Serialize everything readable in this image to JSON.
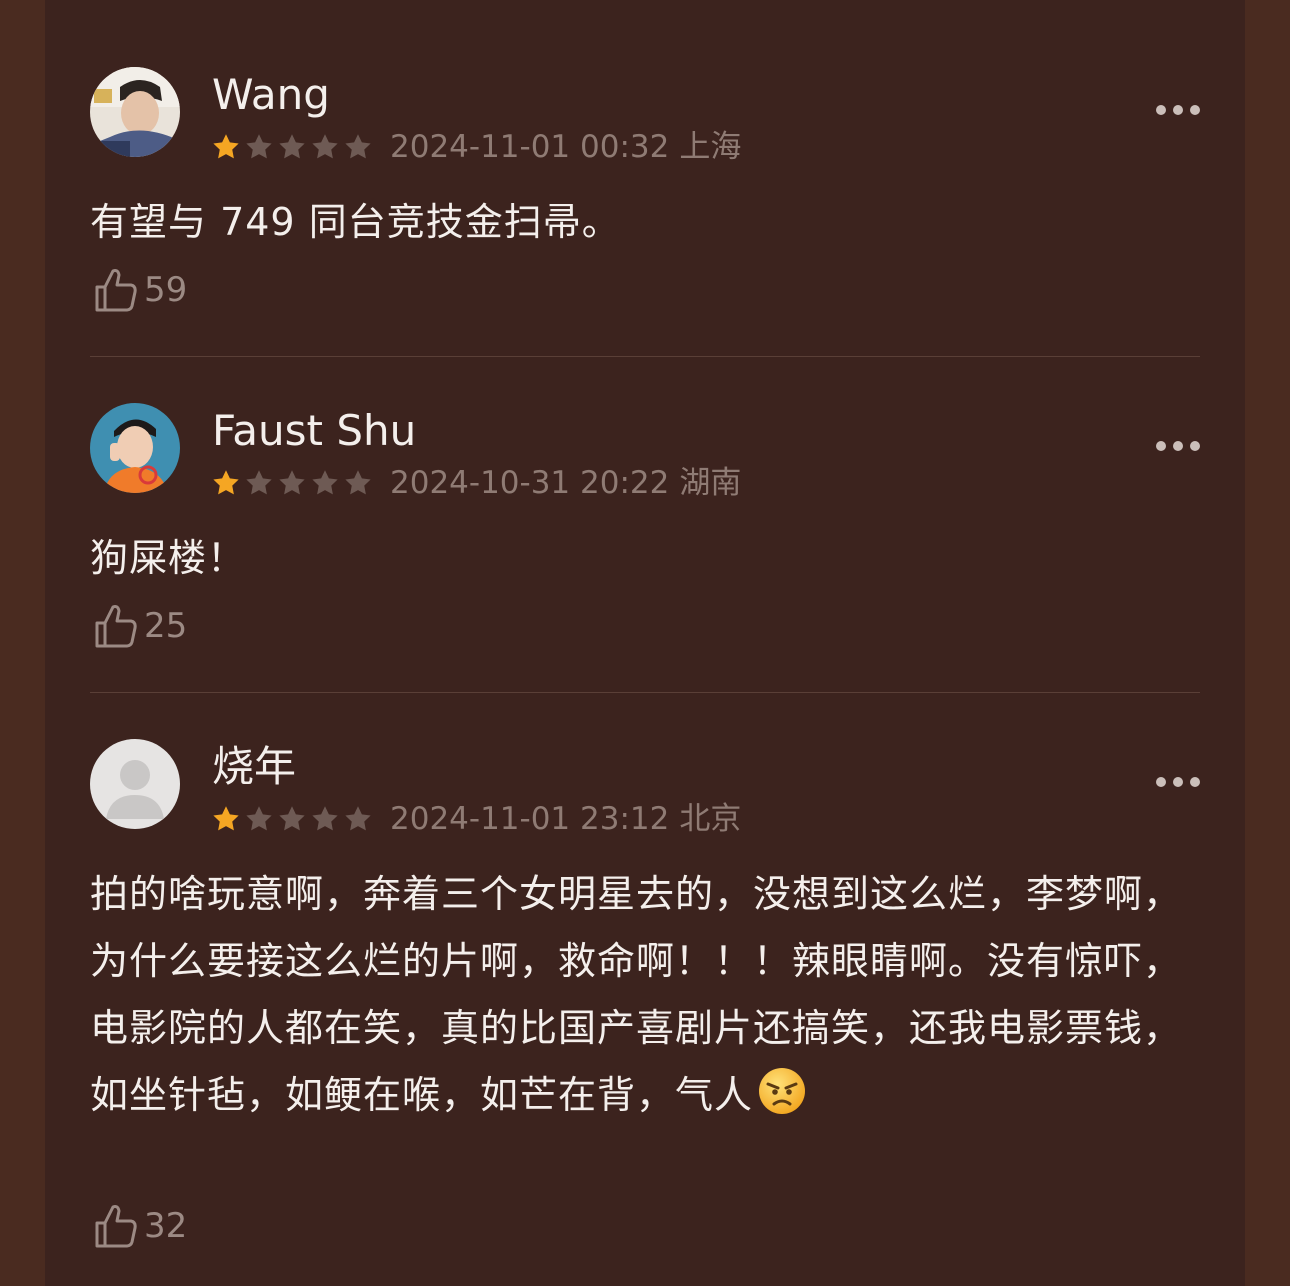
{
  "reviews": [
    {
      "username": "Wang",
      "rating": 1,
      "rating_max": 5,
      "date": "2024-11-01 00:32",
      "location": "上海",
      "content": "有望与 749 同台竞技金扫帚。",
      "likes": "59"
    },
    {
      "username": "Faust Shu",
      "rating": 1,
      "rating_max": 5,
      "date": "2024-10-31 20:22",
      "location": "湖南",
      "content": "狗屎楼！",
      "likes": "25"
    },
    {
      "username": "烧年",
      "rating": 1,
      "rating_max": 5,
      "date": "2024-11-01 23:12",
      "location": "北京",
      "content": "拍的啥玩意啊，奔着三个女明星去的，没想到这么烂，李梦啊，为什么要接这么烂的片啊，救命啊！！！辣眼睛啊。没有惊吓，电影院的人都在笑，真的比国产喜剧片还搞笑，还我电影票钱，如坐针毡，如鲠在喉，如芒在背，气人",
      "likes": "32"
    }
  ],
  "icons": {
    "star_filled_color": "#f5a623",
    "star_empty_color": "#6e5a54",
    "more": "more-dots-icon",
    "like": "thumbs-up-icon",
    "emoji": "angry-face-emoji-icon"
  }
}
